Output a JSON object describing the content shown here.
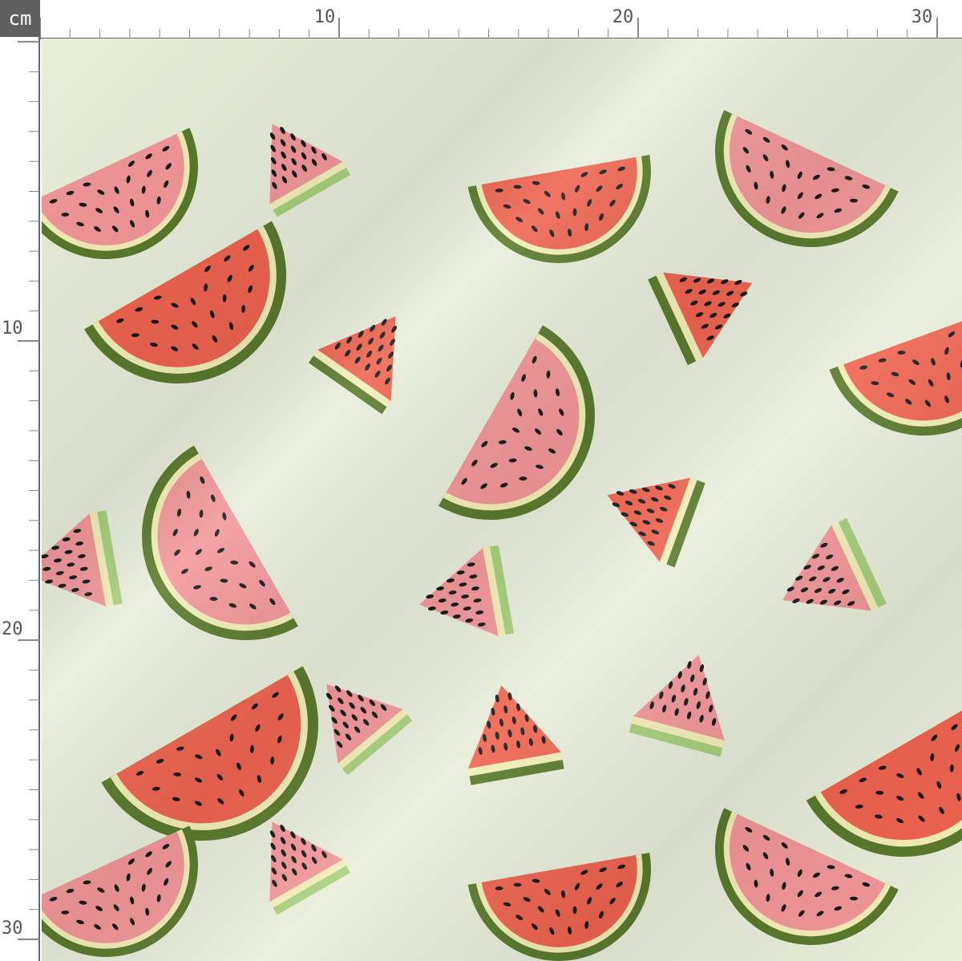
{
  "ruler": {
    "unit": "cm",
    "top_labels": [
      "10",
      "20",
      "30"
    ],
    "left_labels": [
      "10",
      "20",
      "30"
    ]
  },
  "fabric": {
    "print": "watermelon-slices",
    "colors": {
      "background": "#e9eedb",
      "rind_dark": "#5a7a2c",
      "rind_light": "#a8d07c",
      "pith": "#f4efb8",
      "flesh_red": "#ef6450",
      "flesh_pink": "#f3979a",
      "seed": "#1a1a1a"
    }
  }
}
